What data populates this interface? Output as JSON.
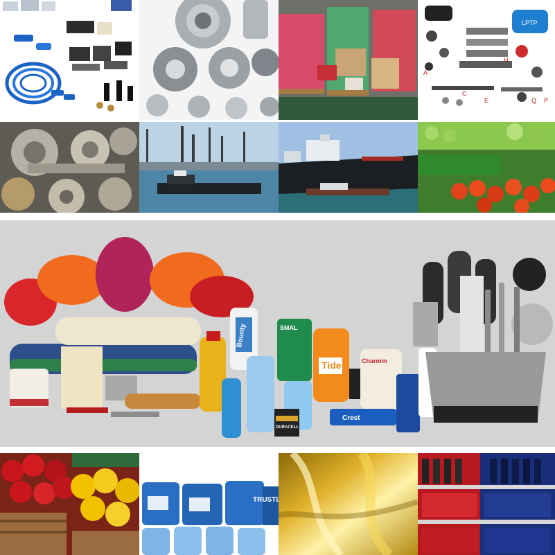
{
  "collage": {
    "tiles": [
      {
        "id": "electronics",
        "subject": "cables-and-electronic-components"
      },
      {
        "id": "metal-parts",
        "subject": "machined-metal-flanges"
      },
      {
        "id": "warehouse",
        "subject": "warehouse-pallets-of-boxes"
      },
      {
        "id": "tool-parts",
        "subject": "power-tool-spare-parts"
      },
      {
        "id": "gears",
        "subject": "industrial-gears"
      },
      {
        "id": "harbor",
        "subject": "harbor-with-tugboat"
      },
      {
        "id": "ship",
        "subject": "cargo-ship"
      },
      {
        "id": "vegetables",
        "subject": "vegetable-market"
      },
      {
        "id": "banner",
        "subject": "household-goods-towels-cleaning-products-kitchen-utensils"
      },
      {
        "id": "peppers",
        "subject": "bell-peppers-in-baskets"
      },
      {
        "id": "drums",
        "subject": "blue-chemical-drums"
      },
      {
        "id": "oil",
        "subject": "golden-oil-pour"
      },
      {
        "id": "shelves",
        "subject": "beverage-store-shelves"
      }
    ],
    "labels": {
      "tool_letters": [
        "A",
        "C",
        "E",
        "H",
        "Q",
        "P"
      ],
      "tool_brand": "LPTP",
      "drum_brand": "TRUSTL",
      "detergent_brand": "Tide",
      "paper_towel_brand": "Bounty",
      "battery_brand": "DURACELL",
      "toothpaste_brand": "Crest",
      "tissue_brand": "Charmin",
      "soap_brand": "SMAL"
    }
  },
  "colors": {
    "banner_bg": "#d4d4d4",
    "towel_red": "#d9262a",
    "towel_orange": "#f06b1e",
    "towel_magenta": "#b0245a",
    "towel_cream": "#efe6cf",
    "towel_blue": "#2d4f8c",
    "towel_green": "#2f7f4a",
    "pepper_red": "#c8161c",
    "pepper_yellow": "#f2c200",
    "drum_blue": "#2a6fc4",
    "oil_gold": "#e0b12a"
  }
}
